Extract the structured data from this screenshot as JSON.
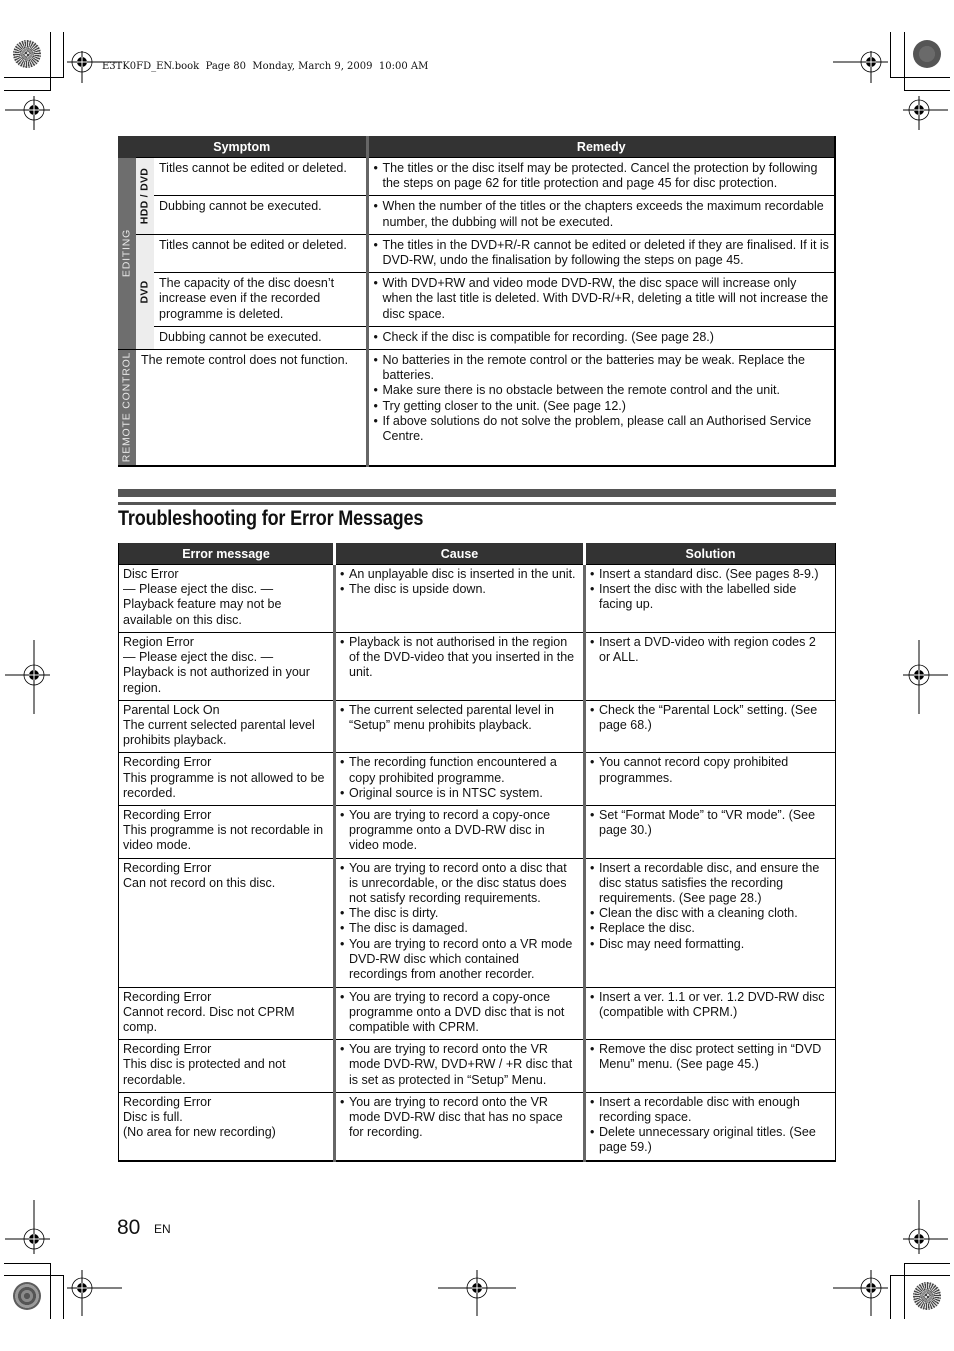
{
  "book_header": "E3TK0FD_EN.book  Page 80  Monday, March 9, 2009  10:00 AM",
  "troubleshooting_table": {
    "headers": {
      "symptom": "Symptom",
      "remedy": "Remedy"
    },
    "group_editing": "EDITING",
    "subgroup_hdd_dvd": "HDD / DVD",
    "subgroup_dvd": "DVD",
    "group_remote": "REMOTE CONTROL",
    "rows": [
      {
        "symptom": "Titles cannot be edited or deleted.",
        "remedy": [
          "The titles or the disc itself may be protected. Cancel the protection by following the steps on page 62 for title protection and page 45 for disc protection."
        ]
      },
      {
        "symptom": "Dubbing cannot be executed.",
        "remedy": [
          "When the number of the titles or the chapters exceeds the maximum recordable number, the dubbing will not be executed."
        ]
      },
      {
        "symptom": "Titles cannot be edited or deleted.",
        "remedy": [
          "The titles in the DVD+R/-R cannot be edited or deleted if they are finalised. If it is DVD-RW, undo the finalisation by following the steps on page 45."
        ]
      },
      {
        "symptom": "The capacity of the disc doesn’t increase even if the recorded programme is deleted.",
        "remedy": [
          "With DVD+RW and video mode DVD-RW, the disc space will increase only when the last title is deleted. With DVD-R/+R, deleting a title will not increase the disc space."
        ]
      },
      {
        "symptom": "Dubbing cannot be executed.",
        "remedy": [
          "Check if the disc is compatible for recording. (See page 28.)"
        ]
      },
      {
        "symptom": "The remote control does not function.",
        "remedy": [
          "No batteries in the remote control or the batteries may be weak. Replace the batteries.",
          "Make sure there is no obstacle between the remote control and the unit.",
          "Try getting closer to the unit. (See page 12.)",
          "If above solutions do not solve the problem, please call an Authorised Service Centre."
        ]
      }
    ]
  },
  "section_title": "Troubleshooting for Error Messages",
  "error_table": {
    "headers": {
      "error": "Error message",
      "cause": "Cause",
      "solution": "Solution"
    },
    "rows": [
      {
        "error": [
          "Disc Error",
          "— Please eject the disc. —",
          "Playback feature may not be available on this disc."
        ],
        "cause": [
          "An unplayable disc is inserted in the unit.",
          "The disc is upside down."
        ],
        "solution": [
          "Insert a standard disc. (See pages 8-9.)",
          "Insert the disc with the labelled side facing up."
        ]
      },
      {
        "error": [
          "Region Error",
          "— Please eject the disc. —",
          "Playback is not authorized in your region."
        ],
        "cause": [
          "Playback is not authorised in the region of the DVD-video that you inserted in the unit."
        ],
        "solution": [
          "Insert a DVD-video with region codes 2 or ALL."
        ]
      },
      {
        "error": [
          "Parental Lock On",
          "The current selected parental level prohibits playback."
        ],
        "cause": [
          "The current selected parental level in “Setup” menu prohibits playback."
        ],
        "solution": [
          "Check the “Parental Lock” setting. (See page 68.)"
        ]
      },
      {
        "error": [
          "Recording Error",
          "This programme is not allowed to be recorded."
        ],
        "cause": [
          "The recording function encountered a copy prohibited programme.",
          "Original source is in NTSC system."
        ],
        "solution": [
          "You cannot record copy prohibited programmes."
        ]
      },
      {
        "error": [
          "Recording Error",
          "This programme is not recordable in video mode."
        ],
        "cause": [
          "You are trying to record a copy-once programme onto a DVD-RW disc in video mode."
        ],
        "solution": [
          "Set “Format Mode” to “VR mode”. (See page 30.)"
        ]
      },
      {
        "error": [
          "Recording Error",
          "Can not record on this disc."
        ],
        "cause": [
          "You are trying to record onto a disc that is unrecordable, or the disc status does not satisfy recording requirements.",
          "The disc is dirty.",
          "The disc is damaged.",
          "You are trying to record onto a VR mode DVD-RW disc which contained recordings from another recorder."
        ],
        "solution": [
          "Insert a recordable disc, and ensure the disc status satisfies the recording requirements. (See page 28.)",
          "Clean the disc with a cleaning cloth.",
          "Replace the disc.",
          "Disc may need formatting."
        ]
      },
      {
        "error": [
          "Recording Error",
          "Cannot record. Disc not CPRM comp."
        ],
        "cause": [
          "You are trying to record a copy-once programme onto a DVD disc that is not compatible with CPRM."
        ],
        "solution": [
          "Insert a ver. 1.1 or ver. 1.2 DVD-RW disc (compatible with CPRM.)"
        ]
      },
      {
        "error": [
          "Recording Error",
          "This disc is protected and not recordable."
        ],
        "cause": [
          "You are trying to record onto the VR mode DVD-RW, DVD+RW / +R disc that is set as protected in “Setup” Menu."
        ],
        "solution": [
          "Remove the disc protect setting in “DVD Menu” menu. (See page 45.)"
        ]
      },
      {
        "error": [
          "Recording Error",
          "Disc is full.",
          "(No area for new recording)"
        ],
        "cause": [
          "You are trying to record onto the VR mode DVD-RW disc that has no space for recording."
        ],
        "solution": [
          "Insert a recordable disc with enough recording space.",
          "Delete unnecessary original titles. (See page 59.)"
        ]
      }
    ]
  },
  "footer": {
    "page_number": "80",
    "language": "EN"
  }
}
